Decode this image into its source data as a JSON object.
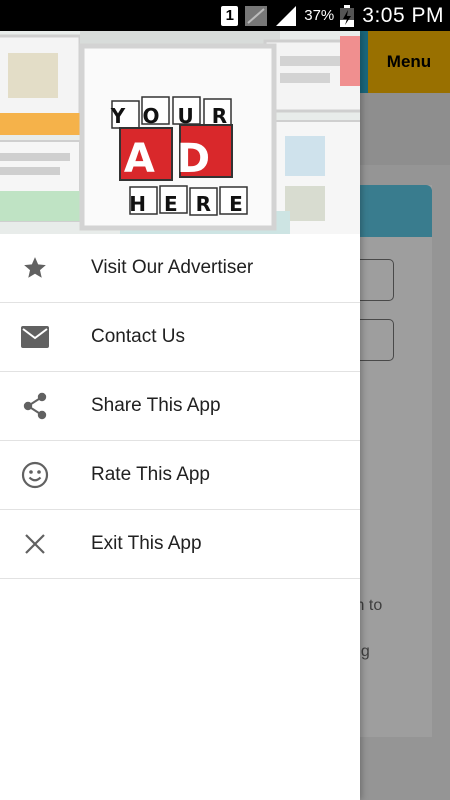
{
  "status_bar": {
    "sim_slot": "1",
    "battery_percent": "37%",
    "time": "3:05 PM"
  },
  "app_bar": {
    "menu_label": "Menu"
  },
  "background_text": {
    "fragment_1": "in to",
    "fragment_2": "ng"
  },
  "drawer": {
    "banner": {
      "line1": "YOUR",
      "line2": "AD",
      "line3": "HERE"
    },
    "items": [
      {
        "label": "Visit Our Advertiser",
        "icon": "star-icon"
      },
      {
        "label": "Contact Us",
        "icon": "mail-icon"
      },
      {
        "label": "Share This App",
        "icon": "share-icon"
      },
      {
        "label": "Rate This App",
        "icon": "smiley-icon"
      },
      {
        "label": "Exit This App",
        "icon": "close-icon"
      }
    ]
  },
  "colors": {
    "app_bar": "#2aa7c9",
    "menu_button": "#f7b500",
    "ad_tile": "#d9282b",
    "icon_gray": "#616161"
  }
}
